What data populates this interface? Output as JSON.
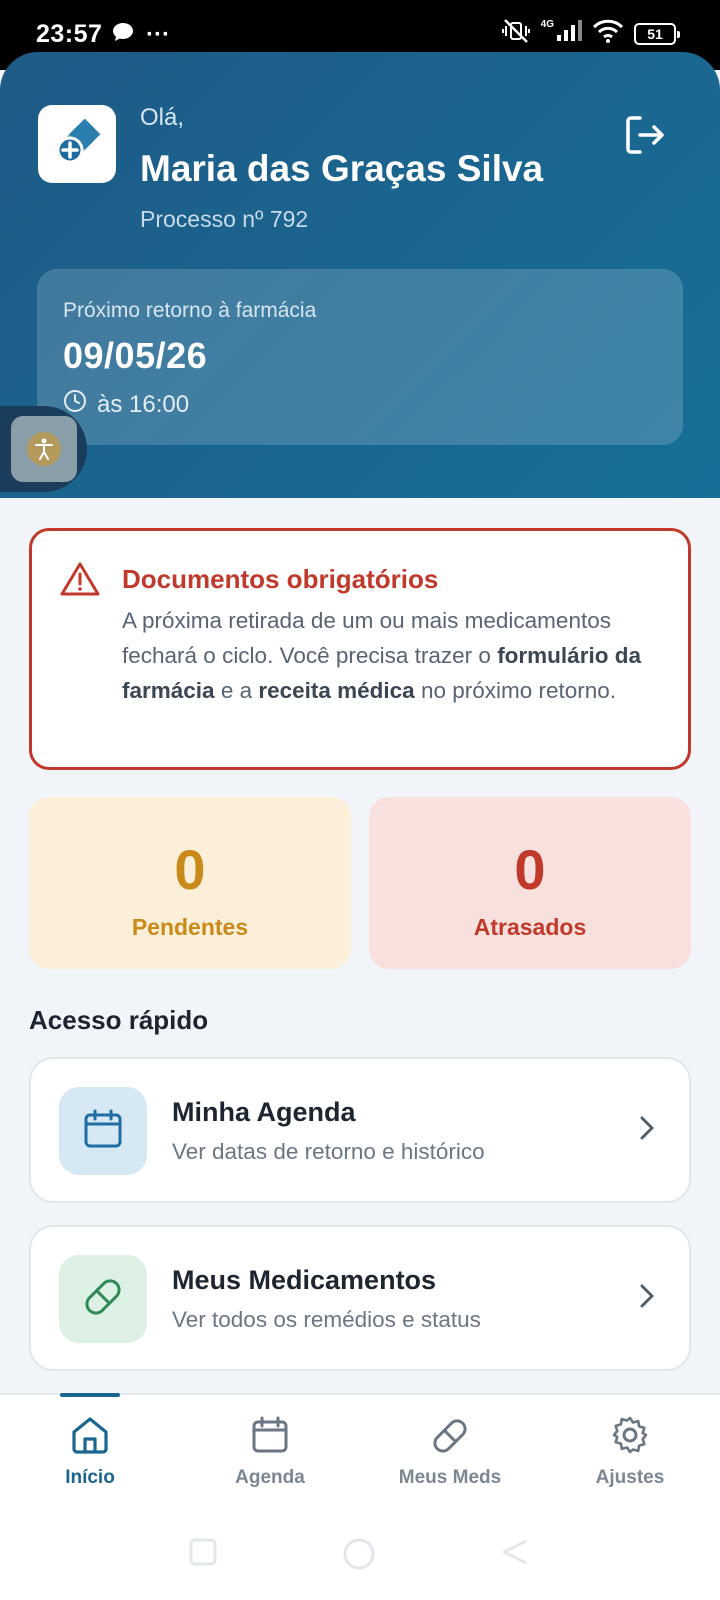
{
  "status_bar": {
    "time": "23:57",
    "dots": "···",
    "network": "4G",
    "battery": "51"
  },
  "header": {
    "greeting": "Olá,",
    "user_name": "Maria das Graças Silva",
    "process": "Processo nº 792"
  },
  "next_return": {
    "label": "Próximo retorno à farmácia",
    "date": "09/05/26",
    "time": "às 16:00"
  },
  "alert": {
    "title": "Documentos obrigatórios",
    "body_1": "A próxima retirada de um ou mais medicamentos fechará o ciclo. Você precisa trazer o ",
    "bold_1": "formulário da farmácia",
    "body_2": " e a ",
    "bold_2": "receita médica",
    "body_3": " no próximo retorno."
  },
  "stats": {
    "pending": {
      "value": "0",
      "label": "Pendentes"
    },
    "overdue": {
      "value": "0",
      "label": "Atrasados"
    }
  },
  "quick_access": {
    "title": "Acesso rápido",
    "items": [
      {
        "title": "Minha Agenda",
        "subtitle": "Ver datas de retorno e histórico",
        "icon": "calendar-icon"
      },
      {
        "title": "Meus Medicamentos",
        "subtitle": "Ver todos os remédios e status",
        "icon": "pill-icon"
      }
    ]
  },
  "bottom_nav": {
    "items": [
      {
        "label": "Início",
        "icon": "home-icon",
        "active": true
      },
      {
        "label": "Agenda",
        "icon": "calendar-icon",
        "active": false
      },
      {
        "label": "Meus Meds",
        "icon": "pill-icon",
        "active": false
      },
      {
        "label": "Ajustes",
        "icon": "gear-icon",
        "active": false
      }
    ]
  },
  "colors": {
    "header_primary": "#1a6690",
    "alert_red": "#c0392b",
    "pending_amber": "#c98a19",
    "active_nav": "#1a6690"
  }
}
